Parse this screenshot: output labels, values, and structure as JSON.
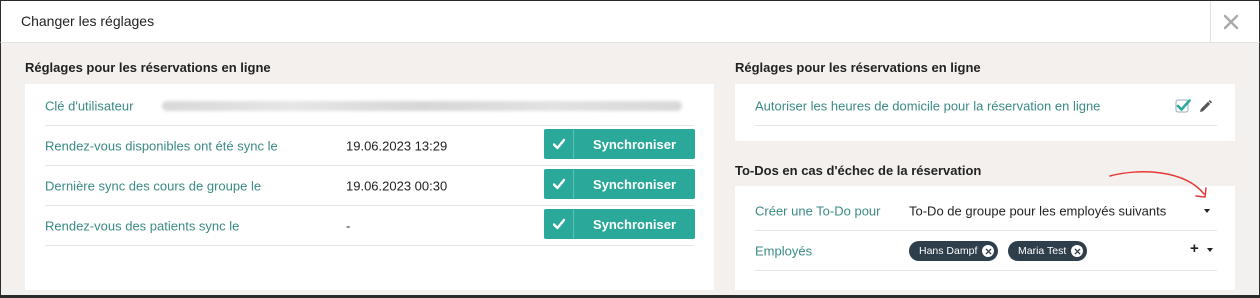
{
  "modal": {
    "title": "Changer les réglages",
    "close_icon": "close-icon"
  },
  "left_section": {
    "title": "Réglages pour les réservations en ligne",
    "rows": [
      {
        "label": "Clé d'utilisateur",
        "value_blurred": true
      },
      {
        "label": "Rendez-vous disponibles ont été sync le",
        "value": "19.06.2023 13:29",
        "button": "Synchroniser"
      },
      {
        "label": "Dernière sync des cours de groupe le",
        "value": "19.06.2023 00:30",
        "button": "Synchroniser"
      },
      {
        "label": "Rendez-vous des patients sync le",
        "value": "-",
        "button": "Synchroniser"
      }
    ]
  },
  "right_section": {
    "title": "Réglages pour les réservations en ligne",
    "rows": [
      {
        "label": "Autoriser les heures de domicile pour la réservation en ligne",
        "checked": true
      }
    ]
  },
  "todo_section": {
    "title": "To-Dos en cas d'échec de la réservation",
    "create_label": "Créer une To-Do pour",
    "create_value": "To-Do de groupe pour les employés suivants",
    "employees_label": "Employés",
    "employees": [
      "Hans Dampf",
      "Maria Test"
    ],
    "add_symbol": "+"
  },
  "colors": {
    "accent": "#2aa899",
    "label_teal": "#3a8a86",
    "tag_bg": "#2e3e4b",
    "annotation_red": "#e53935",
    "page_bg": "#f3f0ed"
  },
  "icons": {
    "check": "check-icon",
    "checkbox": "checkbox-checked-icon",
    "edit": "pencil-icon",
    "caret": "chevron-down-icon",
    "remove": "remove-tag-icon"
  }
}
